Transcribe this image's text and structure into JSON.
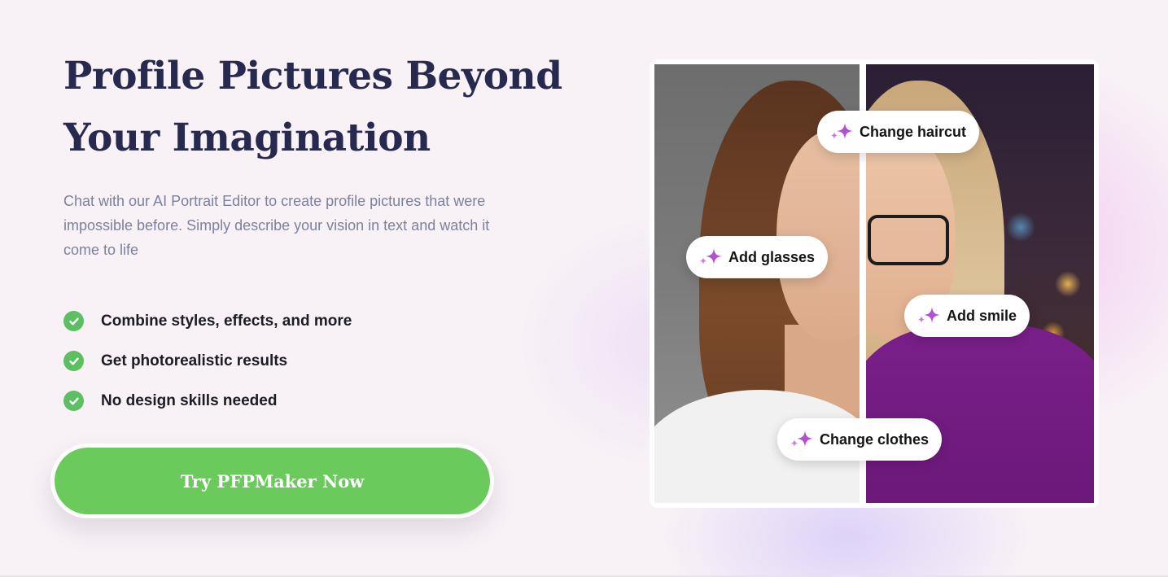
{
  "hero": {
    "title_line1": "Profile Pictures Beyond",
    "title_line2": "Your Imagination",
    "subtitle": "Chat with our AI Portrait Editor to create profile pictures that were impossible before. Simply describe your vision in text and watch it come to life",
    "features": [
      {
        "label": "Combine styles, effects, and more",
        "icon": "check-circle-icon"
      },
      {
        "label": "Get photorealistic results",
        "icon": "check-circle-icon"
      },
      {
        "label": "No design skills needed",
        "icon": "check-circle-icon"
      }
    ],
    "cta_label": "Try PFPMaker Now"
  },
  "preview": {
    "tags": [
      {
        "label": "Change haircut",
        "icon": "sparkle-icon"
      },
      {
        "label": "Add glasses",
        "icon": "sparkle-icon"
      },
      {
        "label": "Add smile",
        "icon": "sparkle-icon"
      },
      {
        "label": "Change clothes",
        "icon": "sparkle-icon"
      }
    ]
  },
  "colors": {
    "title": "#28294f",
    "subtitle": "#7b819e",
    "check": "#5cbf61",
    "cta": "#6aca5c",
    "sparkle": "#b44fd1",
    "sweater": "#7a1f8a",
    "background": "#f8f1f6"
  }
}
